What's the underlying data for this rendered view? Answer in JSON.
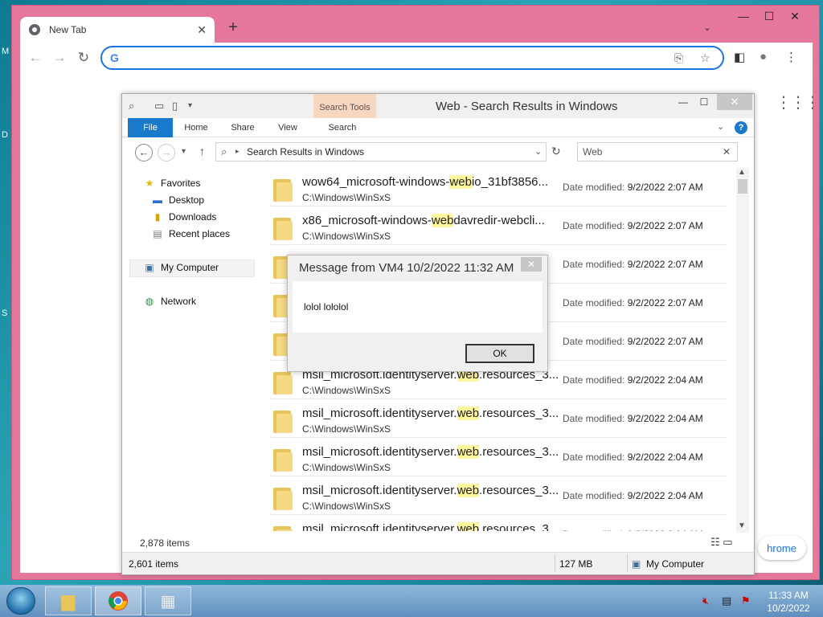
{
  "desktop": {
    "edge_letters": [
      "M",
      "D",
      "S"
    ]
  },
  "chrome": {
    "tab_title": "New Tab",
    "tab_close": "✕",
    "new_tab": "+",
    "tab_search": "⌄",
    "minimize": "—",
    "maximize": "☐",
    "close": "✕",
    "back": "←",
    "forward": "→",
    "reload": "↻",
    "omnibox_value": "",
    "omnibox_g": "G",
    "share_icon": "⎘",
    "star_icon": "☆",
    "sidepanel_icon": "◧",
    "profile_icon": "●",
    "menu_icon": "⋮",
    "apps_icon": "⋮⋮⋮",
    "customize_label": "hrome"
  },
  "explorer": {
    "title": "Web - Search Results in Windows",
    "search_tools": "Search Tools",
    "ribbon_tabs": [
      "File",
      "Home",
      "Share",
      "View",
      "Search"
    ],
    "help": "?",
    "address": "Search Results in Windows",
    "search_value": "Web",
    "search_clear": "✕",
    "nav": {
      "favorites": "Favorites",
      "desktop": "Desktop",
      "downloads": "Downloads",
      "recent": "Recent places",
      "my_computer": "My Computer",
      "network": "Network"
    },
    "date_label": "Date modified:",
    "rows": [
      {
        "pre": "wow64_microsoft-windows-",
        "hl": "web",
        "post": "io_31bf3856...",
        "path": "C:\\Windows\\WinSxS",
        "date": "9/2/2022 2:07 AM"
      },
      {
        "pre": "x86_microsoft-windows-",
        "hl": "web",
        "post": "davredir-webcli...",
        "path": "C:\\Windows\\WinSxS",
        "date": "9/2/2022 2:07 AM"
      },
      {
        "pre": "",
        "hl": "",
        "post": "",
        "path": "",
        "date": "9/2/2022 2:07 AM"
      },
      {
        "pre": "",
        "hl": "",
        "post": "",
        "path": "",
        "date": "9/2/2022 2:07 AM"
      },
      {
        "pre": "",
        "hl": "",
        "post": "",
        "path": "",
        "date": "9/2/2022 2:07 AM"
      },
      {
        "pre": "msil_microsoft.identityserver.",
        "hl": "web",
        "post": ".resources_3...",
        "path": "C:\\Windows\\WinSxS",
        "date": "9/2/2022 2:04 AM"
      },
      {
        "pre": "msil_microsoft.identityserver.",
        "hl": "web",
        "post": ".resources_3...",
        "path": "C:\\Windows\\WinSxS",
        "date": "9/2/2022 2:04 AM"
      },
      {
        "pre": "msil_microsoft.identityserver.",
        "hl": "web",
        "post": ".resources_3...",
        "path": "C:\\Windows\\WinSxS",
        "date": "9/2/2022 2:04 AM"
      },
      {
        "pre": "msil_microsoft.identityserver.",
        "hl": "web",
        "post": ".resources_3...",
        "path": "C:\\Windows\\WinSxS",
        "date": "9/2/2022 2:04 AM"
      },
      {
        "pre": "msil_microsoft.identityserver.",
        "hl": "web",
        "post": ".resources_3...",
        "path": "",
        "date": "9/2/2022 2:04 AM"
      }
    ],
    "items_count": "2,878 items",
    "status_items": "2,601 items",
    "status_size": "127 MB",
    "status_location": "My Computer"
  },
  "message_box": {
    "title": "Message from VM4 10/2/2022 11:32 AM",
    "body": "lolol lololol",
    "ok": "OK",
    "close": "✕"
  },
  "taskbar": {
    "time": "11:33 AM",
    "date": "10/2/2022",
    "tray_icons": [
      "speaker-muted-icon",
      "network-icon",
      "action-center-icon"
    ]
  }
}
